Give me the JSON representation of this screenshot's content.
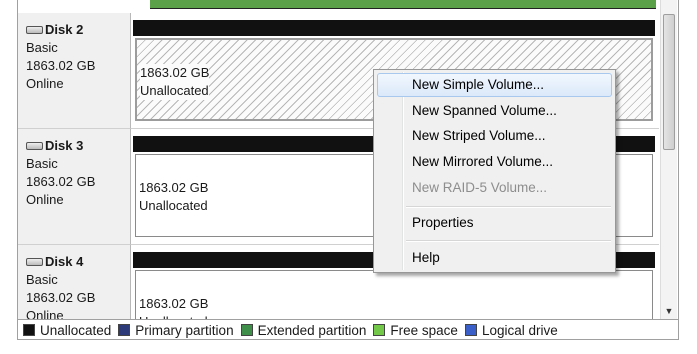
{
  "disks": [
    {
      "name": "Disk 2",
      "type": "Basic",
      "size": "1863.02 GB",
      "status": "Online",
      "partition": {
        "size": "1863.02 GB",
        "state": "Unallocated"
      }
    },
    {
      "name": "Disk 3",
      "type": "Basic",
      "size": "1863.02 GB",
      "status": "Online",
      "partition": {
        "size": "1863.02 GB",
        "state": "Unallocated"
      }
    },
    {
      "name": "Disk 4",
      "type": "Basic",
      "size": "1863.02 GB",
      "status": "Online",
      "partition": {
        "size": "1863.02 GB",
        "state": "Unallocated"
      }
    }
  ],
  "context_menu": {
    "items": [
      {
        "label": "New Simple Volume...",
        "enabled": true,
        "selected": true
      },
      {
        "label": "New Spanned Volume...",
        "enabled": true
      },
      {
        "label": "New Striped Volume...",
        "enabled": true
      },
      {
        "label": "New Mirrored Volume...",
        "enabled": true
      },
      {
        "label": "New RAID-5 Volume...",
        "enabled": false
      },
      {
        "label": "Properties",
        "enabled": true
      },
      {
        "label": "Help",
        "enabled": true
      }
    ]
  },
  "legend": [
    {
      "label": "Unallocated",
      "color": "#111111"
    },
    {
      "label": "Primary partition",
      "color": "#2c3a7a"
    },
    {
      "label": "Extended partition",
      "color": "#3f8f4a"
    },
    {
      "label": "Free space",
      "color": "#73c84a"
    },
    {
      "label": "Logical drive",
      "color": "#3a5fc8"
    }
  ],
  "icons": {
    "disk": "disk-drive-icon",
    "scroll_down": "scroll-down-arrow-icon"
  }
}
